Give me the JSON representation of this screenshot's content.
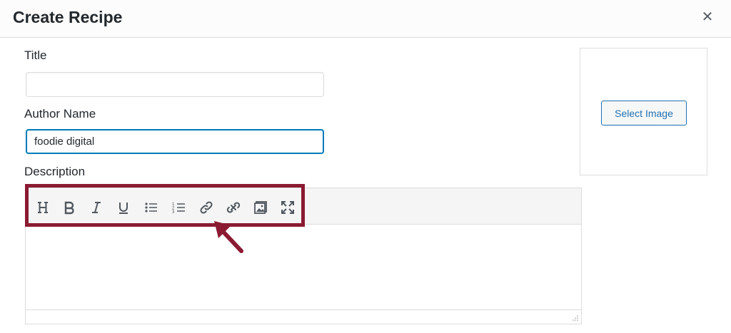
{
  "modal": {
    "title": "Create Recipe",
    "close_icon": "close-icon"
  },
  "form": {
    "title_label": "Title",
    "title_value": "",
    "author_label": "Author Name",
    "author_value": "foodie digital",
    "description_label": "Description"
  },
  "image": {
    "select_label": "Select Image"
  },
  "toolbar": {
    "buttons": [
      "heading-icon",
      "bold-icon",
      "italic-icon",
      "underline-icon",
      "bullet-list-icon",
      "numbered-list-icon",
      "link-icon",
      "unlink-icon",
      "insert-image-icon",
      "fullscreen-icon"
    ]
  },
  "annotation": {
    "highlight_color": "#8b1a32"
  },
  "colors": {
    "accent": "#2271b1",
    "focus": "#007cba"
  }
}
